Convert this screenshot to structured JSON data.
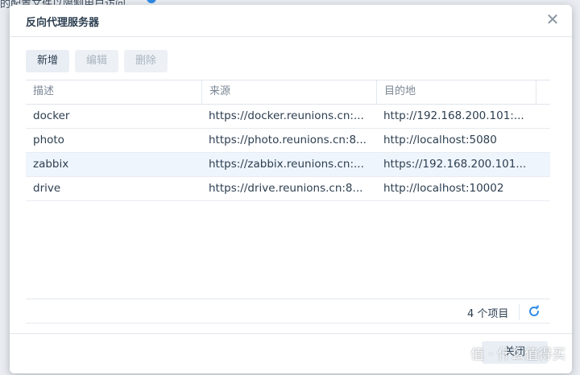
{
  "background": {
    "text": "的配置文件以限制用户访问。"
  },
  "dialog": {
    "title": "反向代理服务器",
    "toolbar": {
      "add_label": "新增",
      "edit_label": "编辑",
      "delete_label": "删除"
    },
    "table": {
      "columns": [
        "描述",
        "来源",
        "目的地"
      ],
      "rows": [
        {
          "description": "docker",
          "source": "https://docker.reunions.cn:...",
          "destination": "http://192.168.200.101:...",
          "selected": false
        },
        {
          "description": "photo",
          "source": "https://photo.reunions.cn:8...",
          "destination": "http://localhost:5080",
          "selected": false
        },
        {
          "description": "zabbix",
          "source": "https://zabbix.reunions.cn:...",
          "destination": "https://192.168.200.101...",
          "selected": true
        },
        {
          "description": "drive",
          "source": "https://drive.reunions.cn:8...",
          "destination": "http://localhost:10002",
          "selected": false
        }
      ]
    },
    "footer": {
      "item_count": "4 个项目"
    },
    "close_label": "关闭"
  },
  "watermark": "值 · 什么值得买",
  "colors": {
    "accent": "#2f8be6",
    "selected_row": "#eff5fc"
  }
}
